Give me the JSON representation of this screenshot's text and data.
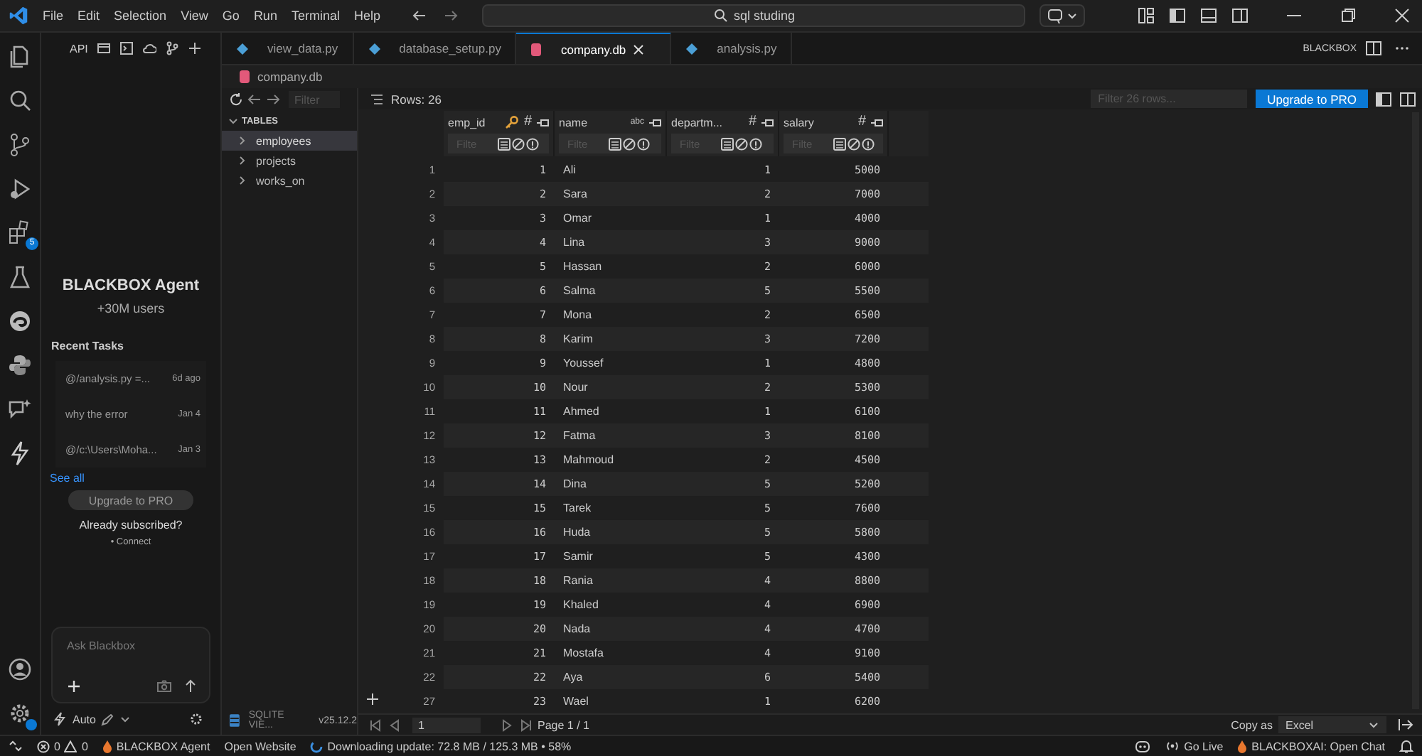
{
  "title_bar": {
    "menu": [
      "File",
      "Edit",
      "Selection",
      "View",
      "Go",
      "Run",
      "Terminal",
      "Help"
    ],
    "search": {
      "value": "sql studing"
    }
  },
  "activity_bar": {
    "extensions_badge": "5"
  },
  "agent_panel": {
    "toolbar_label": "API",
    "title": "BLACKBOX Agent",
    "subtitle": "+30M users",
    "recent_heading": "Recent Tasks",
    "tasks": [
      {
        "title": "@/analysis.py =...",
        "time": "6d ago"
      },
      {
        "title": "why the error",
        "time": "Jan 4"
      },
      {
        "title": "@/c:\\Users\\Moha...",
        "time": "Jan 3"
      }
    ],
    "see_all": "See all",
    "upgrade": "Upgrade to PRO",
    "subscribed": "Already subscribed?",
    "connect": "• Connect",
    "ask": {
      "placeholder": "Ask Blackbox"
    },
    "mode": "Auto"
  },
  "tabs": [
    {
      "label": "view_data.py",
      "kind": "python",
      "selected": false
    },
    {
      "label": "database_setup.py",
      "kind": "python",
      "selected": false
    },
    {
      "label": "company.db",
      "kind": "db",
      "selected": true
    },
    {
      "label": "analysis.py",
      "kind": "python",
      "selected": false
    }
  ],
  "tabs_right": {
    "label": "BLACKBOX"
  },
  "breadcrumb": "company.db",
  "db_tree": {
    "filter": {
      "placeholder": "Filter"
    },
    "heading": "TABLES",
    "tables": [
      {
        "name": "employees",
        "selected": true
      },
      {
        "name": "projects",
        "selected": false
      },
      {
        "name": "works_on",
        "selected": false
      }
    ],
    "footer": {
      "name": "SQLITE VIE...",
      "version": "v25.12.2"
    }
  },
  "grid_toolbar": {
    "rows": "Rows: 26",
    "filter": {
      "placeholder": "Filter 26 rows..."
    },
    "upgrade": "Upgrade to PRO"
  },
  "table": {
    "columns": [
      {
        "name": "emp_id",
        "type_icon": "#",
        "kind": "number",
        "primary_key": true,
        "filter": {
          "placeholder": "Filte"
        }
      },
      {
        "name": "name",
        "type_icon": "abc",
        "kind": "text",
        "primary_key": false,
        "filter": {
          "placeholder": "Filte"
        }
      },
      {
        "name": "departm...",
        "type_icon": "#",
        "kind": "number",
        "primary_key": false,
        "filter": {
          "placeholder": "Filte"
        }
      },
      {
        "name": "salary",
        "type_icon": "#",
        "kind": "number",
        "primary_key": false,
        "filter": {
          "placeholder": "Filte"
        }
      }
    ],
    "row_numbers": [
      "1",
      "2",
      "3",
      "4",
      "5",
      "6",
      "7",
      "8",
      "9",
      "10",
      "11",
      "12",
      "13",
      "14",
      "15",
      "16",
      "17",
      "18",
      "19",
      "20",
      "21",
      "22",
      "27"
    ],
    "rows": [
      [
        "1",
        "Ali",
        "1",
        "5000"
      ],
      [
        "2",
        "Sara",
        "2",
        "7000"
      ],
      [
        "3",
        "Omar",
        "1",
        "4000"
      ],
      [
        "4",
        "Lina",
        "3",
        "9000"
      ],
      [
        "5",
        "Hassan",
        "2",
        "6000"
      ],
      [
        "6",
        "Salma",
        "5",
        "5500"
      ],
      [
        "7",
        "Mona",
        "2",
        "6500"
      ],
      [
        "8",
        "Karim",
        "3",
        "7200"
      ],
      [
        "9",
        "Youssef",
        "1",
        "4800"
      ],
      [
        "10",
        "Nour",
        "2",
        "5300"
      ],
      [
        "11",
        "Ahmed",
        "1",
        "6100"
      ],
      [
        "12",
        "Fatma",
        "3",
        "8100"
      ],
      [
        "13",
        "Mahmoud",
        "2",
        "4500"
      ],
      [
        "14",
        "Dina",
        "5",
        "5200"
      ],
      [
        "15",
        "Tarek",
        "5",
        "7600"
      ],
      [
        "16",
        "Huda",
        "5",
        "5800"
      ],
      [
        "17",
        "Samir",
        "5",
        "4300"
      ],
      [
        "18",
        "Rania",
        "4",
        "8800"
      ],
      [
        "19",
        "Khaled",
        "4",
        "6900"
      ],
      [
        "20",
        "Nada",
        "4",
        "4700"
      ],
      [
        "21",
        "Mostafa",
        "4",
        "9100"
      ],
      [
        "22",
        "Aya",
        "6",
        "5400"
      ],
      [
        "23",
        "Wael",
        "1",
        "6200"
      ]
    ]
  },
  "pagination": {
    "page_input": "1",
    "page_label": "Page 1 / 1",
    "copy_label": "Copy as",
    "copy_format": "Excel"
  },
  "status_bar": {
    "errors": "0",
    "warnings": "0",
    "agent": "BLACKBOX Agent",
    "website": "Open Website",
    "download": "Downloading update: 72.8 MB / 125.3 MB • 58%",
    "live": "Go Live",
    "chat": "BLACKBOXAI: Open Chat"
  }
}
